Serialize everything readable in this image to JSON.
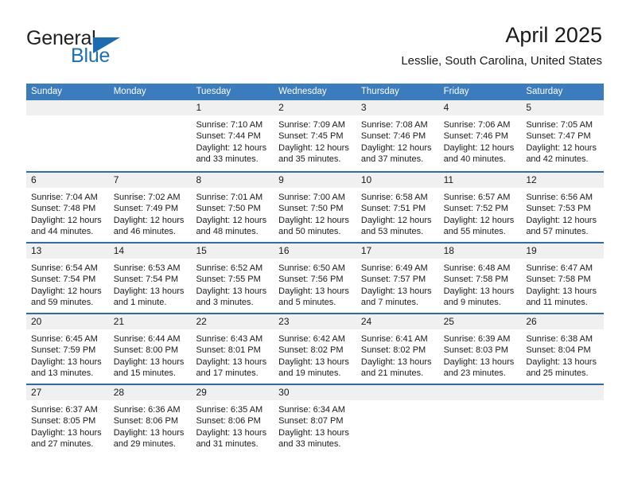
{
  "brand": {
    "name_part1": "General",
    "name_part2": "Blue"
  },
  "header": {
    "title": "April 2025",
    "subtitle": "Lesslie, South Carolina, United States"
  },
  "colors": {
    "header_blue": "#3a7cbe",
    "row_divider_blue": "#2f6cad",
    "day_band_gray": "#f0f0f0",
    "brand_blue": "#1d6fb8"
  },
  "weekdays": [
    "Sunday",
    "Monday",
    "Tuesday",
    "Wednesday",
    "Thursday",
    "Friday",
    "Saturday"
  ],
  "weeks": [
    [
      {
        "day": "",
        "sunrise": "",
        "sunset": "",
        "daylight1": "",
        "daylight2": "",
        "empty": true
      },
      {
        "day": "",
        "sunrise": "",
        "sunset": "",
        "daylight1": "",
        "daylight2": "",
        "empty": true
      },
      {
        "day": "1",
        "sunrise": "Sunrise: 7:10 AM",
        "sunset": "Sunset: 7:44 PM",
        "daylight1": "Daylight: 12 hours",
        "daylight2": "and 33 minutes."
      },
      {
        "day": "2",
        "sunrise": "Sunrise: 7:09 AM",
        "sunset": "Sunset: 7:45 PM",
        "daylight1": "Daylight: 12 hours",
        "daylight2": "and 35 minutes."
      },
      {
        "day": "3",
        "sunrise": "Sunrise: 7:08 AM",
        "sunset": "Sunset: 7:46 PM",
        "daylight1": "Daylight: 12 hours",
        "daylight2": "and 37 minutes."
      },
      {
        "day": "4",
        "sunrise": "Sunrise: 7:06 AM",
        "sunset": "Sunset: 7:46 PM",
        "daylight1": "Daylight: 12 hours",
        "daylight2": "and 40 minutes."
      },
      {
        "day": "5",
        "sunrise": "Sunrise: 7:05 AM",
        "sunset": "Sunset: 7:47 PM",
        "daylight1": "Daylight: 12 hours",
        "daylight2": "and 42 minutes."
      }
    ],
    [
      {
        "day": "6",
        "sunrise": "Sunrise: 7:04 AM",
        "sunset": "Sunset: 7:48 PM",
        "daylight1": "Daylight: 12 hours",
        "daylight2": "and 44 minutes."
      },
      {
        "day": "7",
        "sunrise": "Sunrise: 7:02 AM",
        "sunset": "Sunset: 7:49 PM",
        "daylight1": "Daylight: 12 hours",
        "daylight2": "and 46 minutes."
      },
      {
        "day": "8",
        "sunrise": "Sunrise: 7:01 AM",
        "sunset": "Sunset: 7:50 PM",
        "daylight1": "Daylight: 12 hours",
        "daylight2": "and 48 minutes."
      },
      {
        "day": "9",
        "sunrise": "Sunrise: 7:00 AM",
        "sunset": "Sunset: 7:50 PM",
        "daylight1": "Daylight: 12 hours",
        "daylight2": "and 50 minutes."
      },
      {
        "day": "10",
        "sunrise": "Sunrise: 6:58 AM",
        "sunset": "Sunset: 7:51 PM",
        "daylight1": "Daylight: 12 hours",
        "daylight2": "and 53 minutes."
      },
      {
        "day": "11",
        "sunrise": "Sunrise: 6:57 AM",
        "sunset": "Sunset: 7:52 PM",
        "daylight1": "Daylight: 12 hours",
        "daylight2": "and 55 minutes."
      },
      {
        "day": "12",
        "sunrise": "Sunrise: 6:56 AM",
        "sunset": "Sunset: 7:53 PM",
        "daylight1": "Daylight: 12 hours",
        "daylight2": "and 57 minutes."
      }
    ],
    [
      {
        "day": "13",
        "sunrise": "Sunrise: 6:54 AM",
        "sunset": "Sunset: 7:54 PM",
        "daylight1": "Daylight: 12 hours",
        "daylight2": "and 59 minutes."
      },
      {
        "day": "14",
        "sunrise": "Sunrise: 6:53 AM",
        "sunset": "Sunset: 7:54 PM",
        "daylight1": "Daylight: 13 hours",
        "daylight2": "and 1 minute."
      },
      {
        "day": "15",
        "sunrise": "Sunrise: 6:52 AM",
        "sunset": "Sunset: 7:55 PM",
        "daylight1": "Daylight: 13 hours",
        "daylight2": "and 3 minutes."
      },
      {
        "day": "16",
        "sunrise": "Sunrise: 6:50 AM",
        "sunset": "Sunset: 7:56 PM",
        "daylight1": "Daylight: 13 hours",
        "daylight2": "and 5 minutes."
      },
      {
        "day": "17",
        "sunrise": "Sunrise: 6:49 AM",
        "sunset": "Sunset: 7:57 PM",
        "daylight1": "Daylight: 13 hours",
        "daylight2": "and 7 minutes."
      },
      {
        "day": "18",
        "sunrise": "Sunrise: 6:48 AM",
        "sunset": "Sunset: 7:58 PM",
        "daylight1": "Daylight: 13 hours",
        "daylight2": "and 9 minutes."
      },
      {
        "day": "19",
        "sunrise": "Sunrise: 6:47 AM",
        "sunset": "Sunset: 7:58 PM",
        "daylight1": "Daylight: 13 hours",
        "daylight2": "and 11 minutes."
      }
    ],
    [
      {
        "day": "20",
        "sunrise": "Sunrise: 6:45 AM",
        "sunset": "Sunset: 7:59 PM",
        "daylight1": "Daylight: 13 hours",
        "daylight2": "and 13 minutes."
      },
      {
        "day": "21",
        "sunrise": "Sunrise: 6:44 AM",
        "sunset": "Sunset: 8:00 PM",
        "daylight1": "Daylight: 13 hours",
        "daylight2": "and 15 minutes."
      },
      {
        "day": "22",
        "sunrise": "Sunrise: 6:43 AM",
        "sunset": "Sunset: 8:01 PM",
        "daylight1": "Daylight: 13 hours",
        "daylight2": "and 17 minutes."
      },
      {
        "day": "23",
        "sunrise": "Sunrise: 6:42 AM",
        "sunset": "Sunset: 8:02 PM",
        "daylight1": "Daylight: 13 hours",
        "daylight2": "and 19 minutes."
      },
      {
        "day": "24",
        "sunrise": "Sunrise: 6:41 AM",
        "sunset": "Sunset: 8:02 PM",
        "daylight1": "Daylight: 13 hours",
        "daylight2": "and 21 minutes."
      },
      {
        "day": "25",
        "sunrise": "Sunrise: 6:39 AM",
        "sunset": "Sunset: 8:03 PM",
        "daylight1": "Daylight: 13 hours",
        "daylight2": "and 23 minutes."
      },
      {
        "day": "26",
        "sunrise": "Sunrise: 6:38 AM",
        "sunset": "Sunset: 8:04 PM",
        "daylight1": "Daylight: 13 hours",
        "daylight2": "and 25 minutes."
      }
    ],
    [
      {
        "day": "27",
        "sunrise": "Sunrise: 6:37 AM",
        "sunset": "Sunset: 8:05 PM",
        "daylight1": "Daylight: 13 hours",
        "daylight2": "and 27 minutes."
      },
      {
        "day": "28",
        "sunrise": "Sunrise: 6:36 AM",
        "sunset": "Sunset: 8:06 PM",
        "daylight1": "Daylight: 13 hours",
        "daylight2": "and 29 minutes."
      },
      {
        "day": "29",
        "sunrise": "Sunrise: 6:35 AM",
        "sunset": "Sunset: 8:06 PM",
        "daylight1": "Daylight: 13 hours",
        "daylight2": "and 31 minutes."
      },
      {
        "day": "30",
        "sunrise": "Sunrise: 6:34 AM",
        "sunset": "Sunset: 8:07 PM",
        "daylight1": "Daylight: 13 hours",
        "daylight2": "and 33 minutes."
      },
      {
        "day": "",
        "sunrise": "",
        "sunset": "",
        "daylight1": "",
        "daylight2": "",
        "empty": true
      },
      {
        "day": "",
        "sunrise": "",
        "sunset": "",
        "daylight1": "",
        "daylight2": "",
        "empty": true
      },
      {
        "day": "",
        "sunrise": "",
        "sunset": "",
        "daylight1": "",
        "daylight2": "",
        "empty": true
      }
    ]
  ]
}
